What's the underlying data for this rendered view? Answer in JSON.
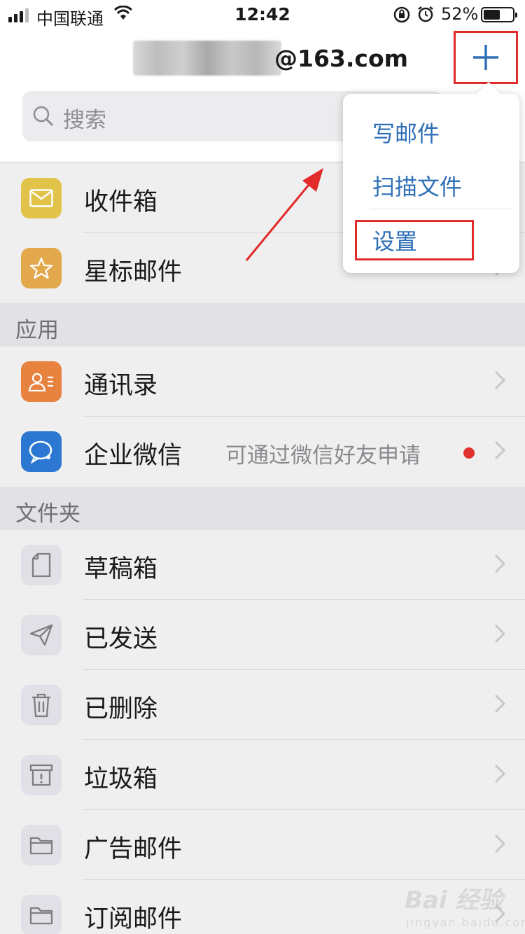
{
  "status_bar": {
    "carrier": "中国联通",
    "time": "12:42",
    "battery": "52%"
  },
  "header": {
    "account_visible": "@163.com",
    "add_icon": "plus-icon"
  },
  "search": {
    "placeholder": "搜索"
  },
  "main_folders": [
    {
      "label": "收件箱",
      "icon": "mail-envelope-icon",
      "color": "#e1c34a"
    },
    {
      "label": "星标邮件",
      "icon": "star-icon",
      "color": "#e3a84c"
    }
  ],
  "sections": {
    "apps": "应用",
    "folders": "文件夹"
  },
  "apps": [
    {
      "label": "通讯录",
      "icon": "contacts-icon",
      "color": "#e8833f"
    },
    {
      "label": "企业微信",
      "icon": "wework-icon",
      "color": "#2b77d1",
      "detail": "可通过微信好友申请"
    }
  ],
  "folders": [
    {
      "label": "草稿箱",
      "icon": "draft-icon"
    },
    {
      "label": "已发送",
      "icon": "send-icon"
    },
    {
      "label": "已删除",
      "icon": "trash-icon"
    },
    {
      "label": "垃圾箱",
      "icon": "spam-icon"
    },
    {
      "label": "广告邮件",
      "icon": "folder-icon"
    },
    {
      "label": "订阅邮件",
      "icon": "folder-icon"
    }
  ],
  "menu": {
    "items": [
      "写邮件",
      "扫描文件",
      "设置"
    ],
    "accent": "#2f6fb6"
  },
  "watermark": {
    "text": "Bai 经验",
    "sub": "jingyan.baidu.com"
  },
  "colors": {
    "annotation": "#e22b2b",
    "accent_blue": "#2f6fb6"
  }
}
